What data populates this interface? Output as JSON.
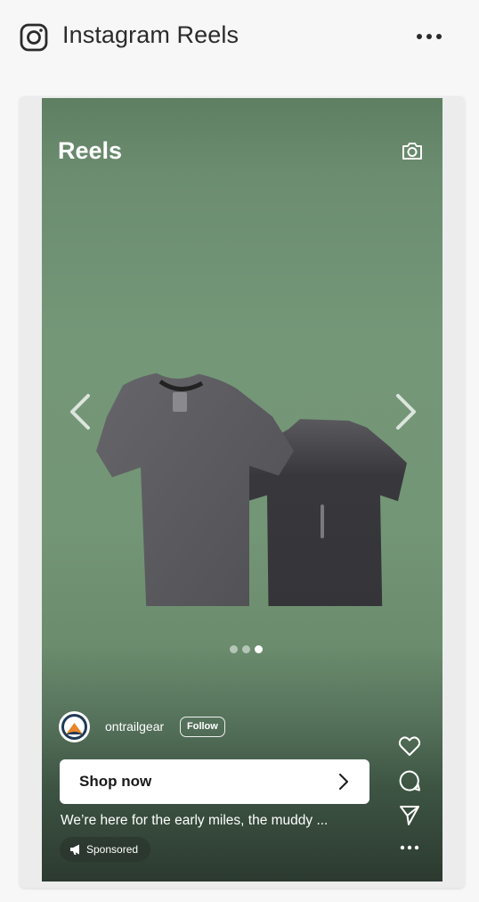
{
  "header": {
    "title": "Instagram Reels",
    "icon": "instagram-icon",
    "more_icon": "more-horizontal-icon"
  },
  "reel": {
    "title": "Reels",
    "camera_icon": "camera-icon",
    "carousel": {
      "slide_count": 3,
      "active_slide": 3
    },
    "account": {
      "username": "ontrailgear",
      "follow_label": "Follow"
    },
    "cta": {
      "label": "Shop now"
    },
    "caption": "We’re here for the early miles, the muddy ...",
    "sponsored_label": "Sponsored",
    "actions": [
      "heart-icon",
      "comment-icon",
      "share-icon",
      "more-icon"
    ]
  },
  "colors": {
    "background_green": "#749778",
    "header_text": "#2b2b2b",
    "shirt_grey": "#5a5a5c",
    "shirt_dark": "#3a3a3e"
  }
}
